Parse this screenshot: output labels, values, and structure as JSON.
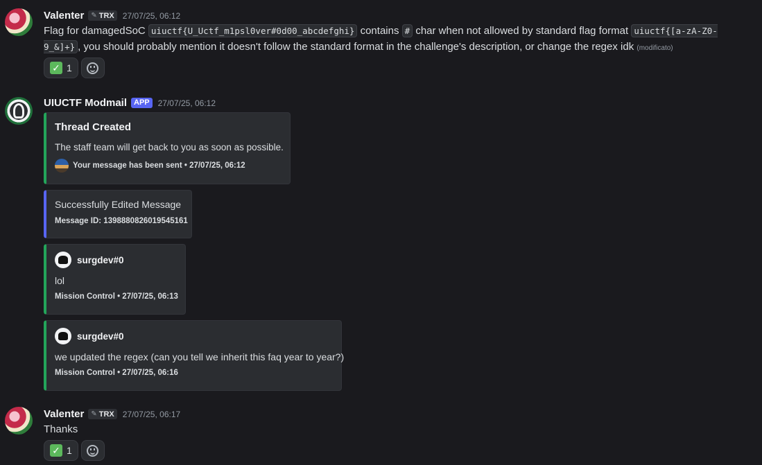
{
  "messages": {
    "m1": {
      "username": "Valenter",
      "tag": "TRX",
      "timestamp": "27/07/25, 06:12",
      "text_1": "Flag for damagedSoC ",
      "code_1": "uiuctf{U_Uctf_m1psl0ver#0d00_abcdefghi}",
      "text_2": " contains ",
      "code_2": "#",
      "text_3": " char when not allowed by standard flag format ",
      "code_3": "uiuctf{[a-zA-Z0-9_&]+}",
      "text_4": ", you should probably mention it doesn't follow the standard format in the challenge's description, or change the regex idk ",
      "edited": "(modificato)",
      "reaction_count": "1"
    },
    "m2": {
      "username": "UIUCTF Modmail",
      "badge": "APP",
      "timestamp": "27/07/25, 06:12",
      "embed1": {
        "title": "Thread Created",
        "description": "The staff team will get back to you as soon as possible.",
        "footer": "Your message has been sent • 27/07/25, 06:12"
      },
      "embed2": {
        "description": "Successfully Edited Message",
        "footer": "Message ID: 1398880826019545161"
      },
      "embed3": {
        "author": "surgdev#0",
        "description": "lol",
        "footer": "Mission Control • 27/07/25, 06:13"
      },
      "embed4": {
        "author": "surgdev#0",
        "description": "we updated the regex (can you tell we inherit this faq year to year?)",
        "footer": "Mission Control • 27/07/25, 06:16"
      }
    },
    "m3": {
      "username": "Valenter",
      "tag": "TRX",
      "timestamp": "27/07/25, 06:17",
      "text": "Thanks",
      "reaction_count": "1"
    }
  },
  "icons": {
    "check": "✓",
    "tag_pen": "✎"
  },
  "colors": {
    "background": "#1a1a1e",
    "embed_green": "#23a55a",
    "embed_blurple": "#5865f2",
    "app_badge": "#5865f2"
  }
}
